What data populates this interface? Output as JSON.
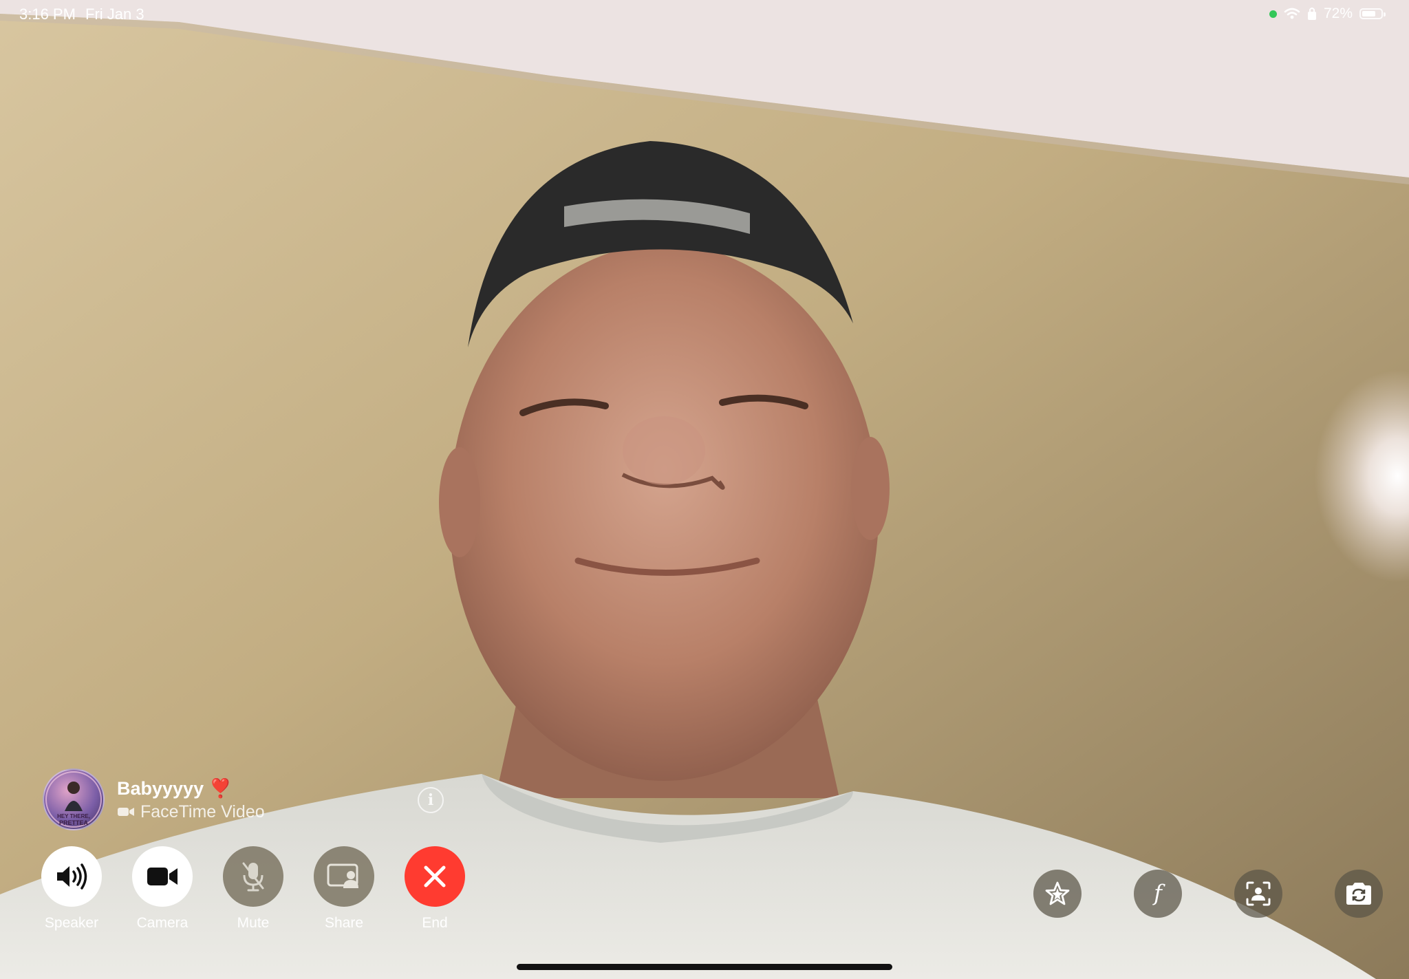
{
  "status_bar": {
    "time": "3:16 PM",
    "date": "Fri Jan 3",
    "battery_percent_label": "72%",
    "battery_level": 0.72,
    "indicator_color": "#34c759",
    "icons": [
      "wifi-icon",
      "lock-rotation-icon",
      "battery-icon"
    ]
  },
  "caller": {
    "name": "Babyyyyy ❣️",
    "call_type": "FaceTime Video",
    "avatar_text": "HEY THERE PRETTEA",
    "icons": [
      "avatar",
      "video-icon",
      "info-icon"
    ]
  },
  "controls": [
    {
      "label": "Speaker",
      "icon": "speaker-icon",
      "style": "white"
    },
    {
      "label": "Camera",
      "icon": "camera-icon",
      "style": "white"
    },
    {
      "label": "Mute",
      "icon": "mic-off-icon",
      "style": "dim"
    },
    {
      "label": "Share",
      "icon": "share-screen-icon",
      "style": "dim"
    },
    {
      "label": "End",
      "icon": "end-call-icon",
      "style": "red",
      "color": "#ff3b30"
    }
  ],
  "effects": [
    {
      "icon": "effects-star-icon"
    },
    {
      "icon": "filters-icon"
    },
    {
      "icon": "portrait-mode-icon"
    },
    {
      "icon": "flip-camera-icon"
    }
  ]
}
